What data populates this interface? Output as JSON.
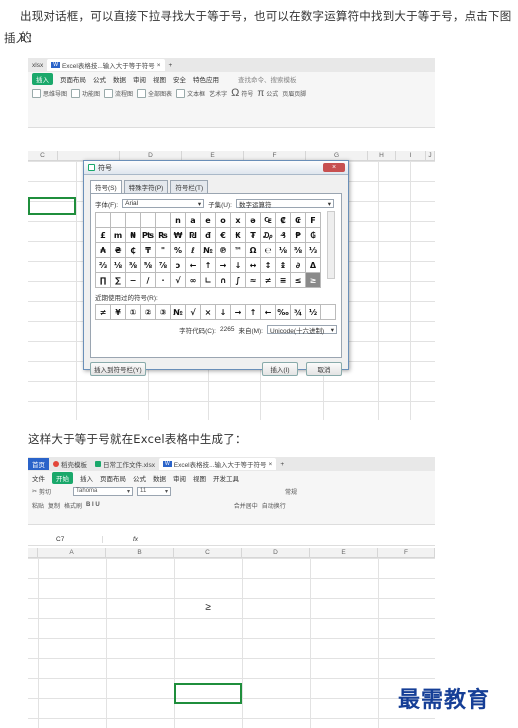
{
  "text": {
    "para1_line1": "出现对话框，可以直接下拉寻找大于等于号，也可以在数字运算符中找到大于等于号，点击下图的",
    "para1_line2": "插入：",
    "para2": "这样大于等于号就在Excel表格中生成了："
  },
  "shot1": {
    "tabs": [
      "xlsx",
      "Excel表格技...输入大于等于符号"
    ],
    "menu": [
      "插入",
      "页面布局",
      "公式",
      "数据",
      "审阅",
      "视图",
      "安全",
      "特色应用"
    ],
    "search": "查找命令、搜索模板",
    "tools": [
      "思维导图",
      "功能图",
      "流程图",
      "全部图表",
      "文本框",
      "艺术字",
      "符号",
      "公式",
      "页眉页脚"
    ],
    "cols": [
      "C",
      "D",
      "E",
      "F",
      "G",
      "H",
      "I",
      "J"
    ],
    "dialog": {
      "title": "符号",
      "close": "×",
      "tabs": [
        "符号(S)",
        "特殊字符(P)",
        "符号栏(T)"
      ],
      "font_label": "字体(F):",
      "font_value": "Arial",
      "subset_label": "子集(U):",
      "subset_value": "数字运算符",
      "symbols": [
        "",
        "",
        "",
        "",
        "",
        "n",
        "a",
        "e",
        "o",
        "x",
        "ə",
        "₠",
        "₡",
        "₢",
        "F",
        "£",
        "m",
        "₦",
        "₧",
        "₨",
        "₩",
        "₪",
        "đ",
        "€",
        "₭",
        "₮",
        "₯",
        "₰",
        "₱",
        "₲",
        "₳",
        "₴",
        "₵",
        "₸",
        "\"",
        "%",
        "ℓ",
        "№",
        "℗",
        "™",
        "Ω",
        "℮",
        "⅛",
        "⅜",
        "⅓",
        "⅔",
        "⅛",
        "⅜",
        "⅝",
        "⅞",
        "ↄ",
        "←",
        "↑",
        "→",
        "↓",
        "↔",
        "↕",
        "↨",
        "∂",
        "Δ",
        "∏",
        "∑",
        "−",
        "∕",
        "·",
        "√",
        "∞",
        "∟",
        "∩",
        "∫",
        "≈",
        "≠",
        "≡",
        "≤",
        "≥"
      ],
      "selected_symbol": "≥",
      "recent_label": "近期使用过的符号(R):",
      "recent": [
        "≠",
        "¥",
        "①",
        "②",
        "③",
        "№",
        "√",
        "×",
        "↓",
        "→",
        "↑",
        "←",
        "‰",
        "¾",
        "½",
        ""
      ],
      "code_label": "字符代码(C):",
      "code_value": "2265",
      "from_label": "来自(M):",
      "from_value": "Unicode(十六进制)",
      "btn_toolbar": "插入到符号栏(Y)",
      "btn_insert": "插入(I)",
      "btn_cancel": "取消"
    }
  },
  "shot2": {
    "tabs": [
      "首页",
      "稻壳模板",
      "日常工作文件.xlsx",
      "Excel表格技...输入大于等于符号"
    ],
    "menu": [
      "文件",
      "开始",
      "插入",
      "页面布局",
      "公式",
      "数据",
      "审阅",
      "视图",
      "开发工具"
    ],
    "clip": [
      "剪切",
      "复制",
      "格式刷",
      "粘贴"
    ],
    "font_name": "Tahoma",
    "font_size": "11",
    "wrap": "合并居中",
    "autowrap": "自动换行",
    "normal": "常规",
    "cell_ref": "C7",
    "fx": "fx",
    "cols": [
      "A",
      "B",
      "C",
      "D",
      "E",
      "F"
    ],
    "cell_value": "≥"
  },
  "watermark": "最需教育",
  "colors": {
    "green": "#1aa86b",
    "select": "#1f8e3c",
    "watermark": "#153e96"
  }
}
